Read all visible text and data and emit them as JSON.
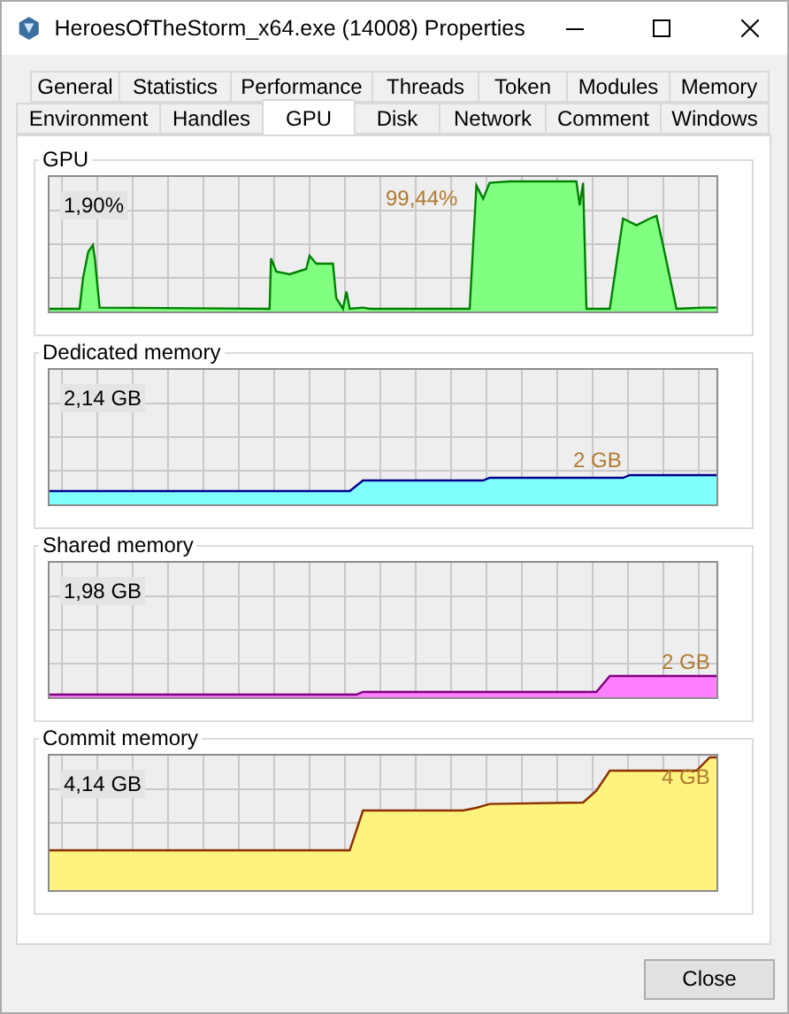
{
  "window": {
    "title": "HeroesOfTheStorm_x64.exe (14008) Properties"
  },
  "tab_rows": [
    {
      "tabs": [
        {
          "label": "General",
          "selected": false
        },
        {
          "label": "Statistics",
          "selected": false
        },
        {
          "label": "Performance",
          "selected": false
        },
        {
          "label": "Threads",
          "selected": false
        },
        {
          "label": "Token",
          "selected": false
        },
        {
          "label": "Modules",
          "selected": false
        },
        {
          "label": "Memory",
          "selected": false
        }
      ]
    },
    {
      "tabs": [
        {
          "label": "Environment",
          "selected": false
        },
        {
          "label": "Handles",
          "selected": false
        },
        {
          "label": "GPU",
          "selected": true
        },
        {
          "label": "Disk",
          "selected": false
        },
        {
          "label": "Network",
          "selected": false
        },
        {
          "label": "Comment",
          "selected": false
        },
        {
          "label": "Windows",
          "selected": false
        }
      ]
    }
  ],
  "graphs": [
    {
      "kind": "gpu",
      "title": "GPU",
      "current": "1,90%",
      "peak": "99,44%",
      "color": "#80ff80"
    },
    {
      "kind": "dedicated",
      "title": "Dedicated memory",
      "current": "2,14 GB",
      "peak": "2 GB",
      "color": "#80ffff"
    },
    {
      "kind": "shared",
      "title": "Shared memory",
      "current": "1,98 GB",
      "peak": "2 GB",
      "color": "#ff80ff"
    },
    {
      "kind": "commit",
      "title": "Commit memory",
      "current": "4,14 GB",
      "peak": "4 GB",
      "color": "#fff380"
    }
  ],
  "buttons": [
    {
      "label": "Close"
    }
  ]
}
